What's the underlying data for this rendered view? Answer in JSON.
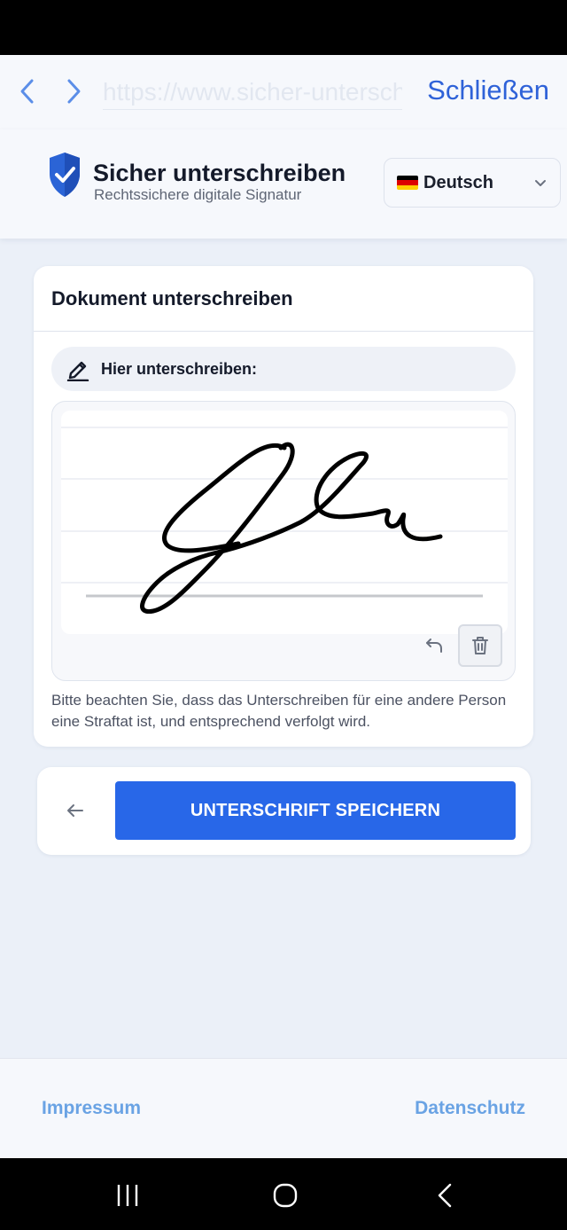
{
  "browser": {
    "url": "https://www.sicher-unterschreiben",
    "close_label": "Schließen"
  },
  "header": {
    "title": "Sicher unterschreiben",
    "subtitle": "Rechtssichere digitale Signatur",
    "language": "Deutsch",
    "flag_colors": [
      "#000000",
      "#dd0000",
      "#ffce00"
    ]
  },
  "card": {
    "title": "Dokument unterschreiben",
    "sign_label": "Hier unterschreiben:",
    "notice": "Bitte beachten Sie, dass das Unterschreiben für eine andere Person eine Straftat ist, und entsprechend verfolgt wird."
  },
  "actions": {
    "save_label": "UNTERSCHRIFT SPEICHERN"
  },
  "footer": {
    "impressum": "Impressum",
    "datenschutz": "Datenschutz"
  },
  "colors": {
    "accent": "#2867e8",
    "link": "#2f62d8",
    "footer_link": "#6aa3e4"
  }
}
